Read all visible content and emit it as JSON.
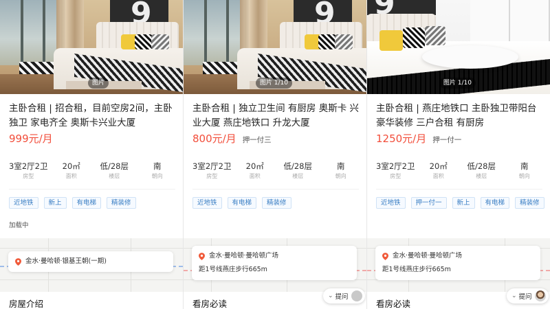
{
  "cards": [
    {
      "photo_count": "图片",
      "title": "主卧合租 | 招合租，目前空房2间，主卧独卫 家电齐全 奥斯卡兴业大厦",
      "price": "999元/月",
      "pay": "",
      "specs": [
        {
          "value": "3室2厅2卫",
          "label": "房型"
        },
        {
          "value": "20㎡",
          "label": "面积"
        },
        {
          "value": "低/28层",
          "label": "楼层"
        },
        {
          "value": "南",
          "label": "朝向"
        }
      ],
      "tags": [
        "近地铁",
        "新上",
        "有电梯",
        "精装修"
      ],
      "loading": "加载中",
      "location": "金水·曼哈顿·银基王朝(一期)",
      "distance": "",
      "section_title": "房屋介绍"
    },
    {
      "photo_count": "图片 1/10",
      "title": "主卧合租 | 独立卫生间 有厨房 奥斯卡 兴业大厦 燕庄地铁口 升龙大厦",
      "price": "800元/月",
      "pay": "押一付三",
      "specs": [
        {
          "value": "3室2厅2卫",
          "label": "房型"
        },
        {
          "value": "20㎡",
          "label": "面积"
        },
        {
          "value": "低/28层",
          "label": "楼层"
        },
        {
          "value": "南",
          "label": "朝向"
        }
      ],
      "tags": [
        "近地铁",
        "有电梯",
        "精装修"
      ],
      "loading": "",
      "location": "金水·曼哈顿·曼哈顿广场",
      "distance": "距1号线燕庄步行665m",
      "section_title": "看房必读",
      "ask_label": "提问"
    },
    {
      "photo_count": "图片 1/10",
      "title": "主卧合租 | 燕庄地铁口 主卧独卫带阳台 豪华装修 三户合租 有厨房",
      "price": "1250元/月",
      "pay": "押一付一",
      "specs": [
        {
          "value": "3室2厅2卫",
          "label": "房型"
        },
        {
          "value": "20㎡",
          "label": "面积"
        },
        {
          "value": "低/28层",
          "label": "楼层"
        },
        {
          "value": "南",
          "label": "朝向"
        }
      ],
      "tags": [
        "近地铁",
        "押一付一",
        "新上",
        "有电梯",
        "精装修"
      ],
      "loading": "",
      "location": "金水·曼哈顿·曼哈顿广场",
      "distance": "距1号线燕庄步行665m",
      "section_title": "看房必读",
      "ask_label": "提问"
    }
  ],
  "colors": {
    "price": "#f24d3a",
    "tag_text": "#3b7fc4",
    "tag_border": "#cfe2f6",
    "pin": "#f05a3a"
  },
  "icons": {
    "location": "location-pin-icon",
    "ask_chevron": "chevron-down-icon"
  }
}
